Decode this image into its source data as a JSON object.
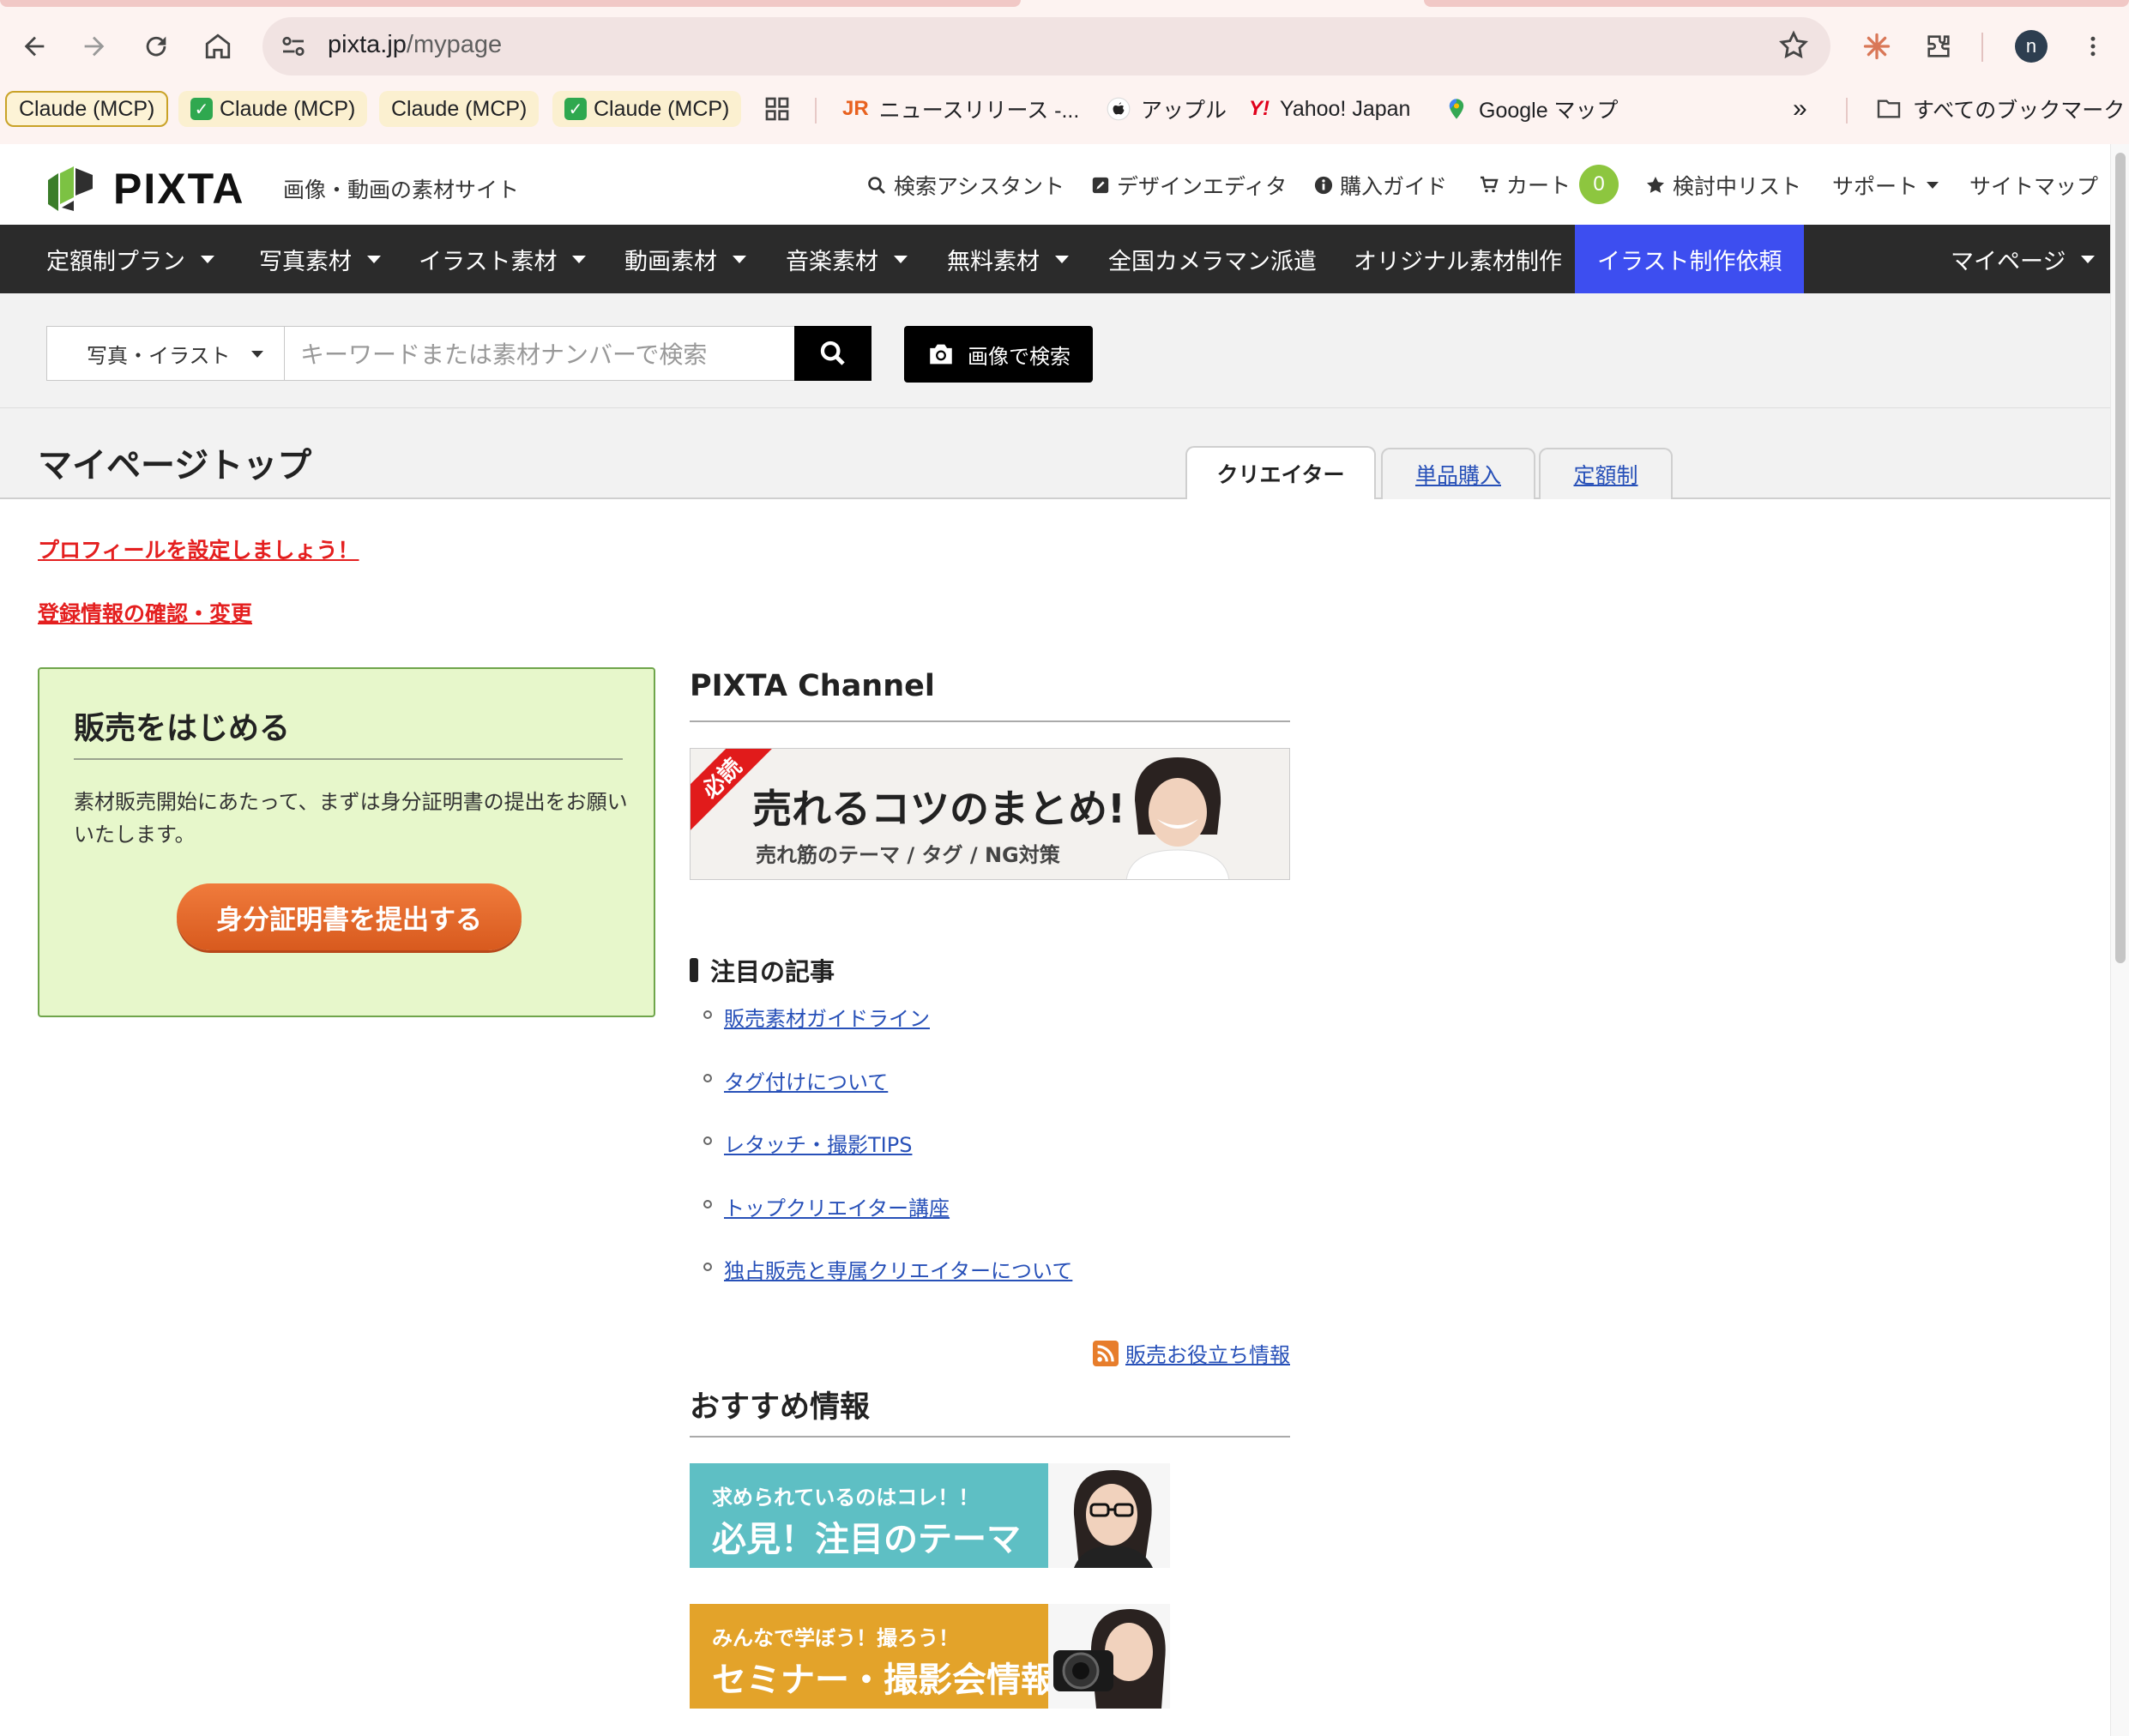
{
  "browser": {
    "url_host": "pixta.jp",
    "url_path": "/mypage",
    "profile_initial": "n",
    "bookmarks": [
      {
        "label": "Claude (MCP)",
        "checked": false
      },
      {
        "label": "Claude (MCP)",
        "checked": true
      },
      {
        "label": "Claude (MCP)",
        "checked": false
      },
      {
        "label": "Claude (MCP)",
        "checked": true
      },
      {
        "label": "ニュースリリース -..."
      },
      {
        "label": "アップル"
      },
      {
        "label": "Yahoo! Japan"
      },
      {
        "label": "Google マップ"
      },
      {
        "label": "すべてのブックマーク"
      }
    ],
    "more_bookmarks": "»"
  },
  "header": {
    "logo": "PIXTA",
    "tagline": "画像・動画の素材サイト",
    "links": {
      "search_assistant": "検索アシスタント",
      "design_editor": "デザインエディタ",
      "purchase_guide": "購入ガイド",
      "cart": "カート",
      "cart_count": "0",
      "wishlist": "検討中リスト",
      "support": "サポート",
      "sitemap": "サイトマップ"
    }
  },
  "mainnav": {
    "items": [
      "定額制プラン",
      "写真素材",
      "イラスト素材",
      "動画素材",
      "音楽素材",
      "無料素材",
      "全国カメラマン派遣",
      "オリジナル素材制作",
      "イラスト制作依頼"
    ],
    "mypage": "マイページ"
  },
  "search": {
    "scope": "写真・イラスト",
    "placeholder": "キーワードまたは素材ナンバーで検索",
    "image_search": "画像で検索"
  },
  "page": {
    "title": "マイページトップ",
    "tabs": [
      "クリエイター",
      "単品購入",
      "定額制"
    ],
    "profile_link": "プロフィールを設定しましょう！",
    "account_link": "登録情報の確認・変更"
  },
  "sell_box": {
    "title": "販売をはじめる",
    "body": "素材販売開始にあたって、まずは身分証明書の提出をお願いいたします。",
    "button": "身分証明書を提出する"
  },
  "channel": {
    "title": "PIXTA Channel",
    "banner_ribbon": "必読",
    "banner_headline": "売れるコツのまとめ!",
    "banner_sub": "売れ筋のテーマ / タグ / NG対策"
  },
  "articles": {
    "title": "注目の記事",
    "items": [
      "販売素材ガイドライン",
      "タグ付けについて",
      "レタッチ・撮影TIPS",
      "トップクリエイター講座",
      "独占販売と専属クリエイターについて"
    ],
    "rss": "販売お役立ち情報"
  },
  "recommend": {
    "title": "おすすめ情報",
    "banners": [
      {
        "line1": "求められているのはコレ！！",
        "line2": "必見！注目のテーマ"
      },
      {
        "line1": "みんなで学ぼう！撮ろう！",
        "line2": "セミナー・撮影会情報"
      }
    ]
  },
  "colors": {
    "nav_bg": "#2b2b2b",
    "nav_highlight": "#3d4ef0",
    "cart_badge": "#8dc63f",
    "link_red": "#e41f1f",
    "link_blue": "#2750b8",
    "sell_box_bg": "#e7f7cb",
    "cta_orange": "#e46a2a"
  }
}
